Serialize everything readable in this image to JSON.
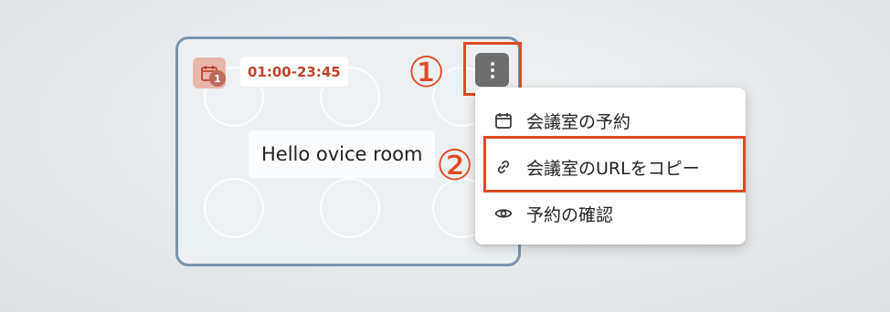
{
  "room": {
    "reservation_count": "1",
    "time_range": "01:00-23:45",
    "name": "Hello ovice room"
  },
  "annotations": {
    "step1": "①",
    "step2": "②",
    "highlight_color": "#e04a25"
  },
  "kebab": {
    "icon": "more-vertical-icon"
  },
  "menu": {
    "items": [
      {
        "label": "会議室の予約",
        "icon": "calendar-icon"
      },
      {
        "label": "会議室のURLをコピー",
        "icon": "link-icon"
      },
      {
        "label": "予約の確認",
        "icon": "eye-icon"
      }
    ]
  },
  "colors": {
    "card_border": "#7a93ad",
    "time_text": "#c0432a",
    "calendar_badge": "#e8b6aa"
  }
}
